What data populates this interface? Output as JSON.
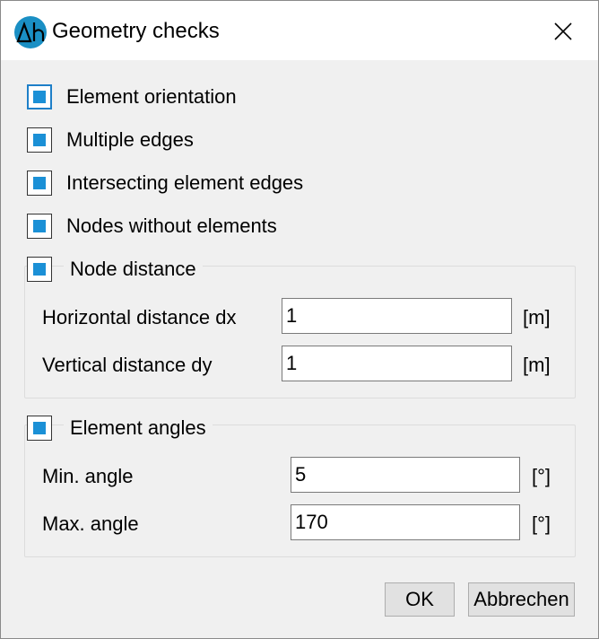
{
  "window": {
    "title": "Geometry checks",
    "app_icon": "delta-h-icon",
    "close_icon": "close-icon"
  },
  "checks": [
    {
      "label": "Element orientation",
      "checked": true
    },
    {
      "label": "Multiple edges",
      "checked": true
    },
    {
      "label": "Intersecting element edges",
      "checked": true
    },
    {
      "label": "Nodes without elements",
      "checked": true
    }
  ],
  "node_distance": {
    "label": "Node distance",
    "checked": true,
    "fields": [
      {
        "label": "Horizontal distance dx",
        "value": "1",
        "unit": "[m]"
      },
      {
        "label": "Vertical distance dy",
        "value": "1",
        "unit": "[m]"
      }
    ]
  },
  "element_angles": {
    "label": "Element angles",
    "checked": true,
    "fields": [
      {
        "label": "Min. angle",
        "value": "5",
        "unit": "[°]"
      },
      {
        "label": "Max. angle",
        "value": "170",
        "unit": "[°]"
      }
    ]
  },
  "buttons": {
    "ok": "OK",
    "cancel": "Abbrechen"
  },
  "colors": {
    "accent": "#1b90d6",
    "app_icon_bg": "#1a8fc4",
    "dialog_bg": "#f0f0f0",
    "titlebar_bg": "#ffffff"
  }
}
